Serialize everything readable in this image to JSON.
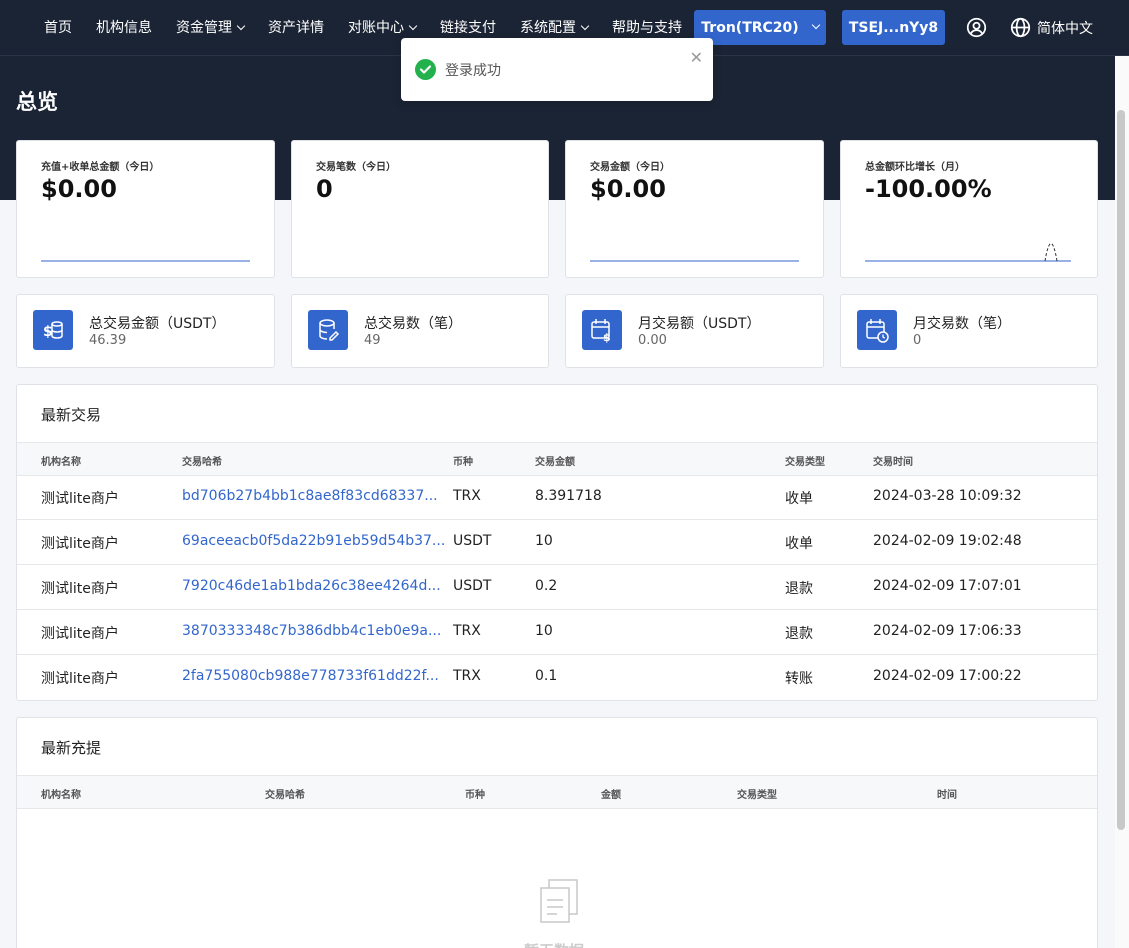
{
  "nav": {
    "items": [
      {
        "label": "首页"
      },
      {
        "label": "机构信息"
      },
      {
        "label": "资金管理"
      },
      {
        "label": "资产详情"
      },
      {
        "label": "对账中心"
      },
      {
        "label": "链接支付"
      },
      {
        "label": "系统配置"
      },
      {
        "label": "帮助与支持"
      }
    ],
    "network_label": "Tron(TRC20)",
    "wallet_label": "TSEJ...nYy8",
    "language": "简体中文",
    "user_icon": "user-circle-icon",
    "globe_icon": "globe-icon"
  },
  "toast": {
    "message": "登录成功",
    "icon": "check-circle-icon",
    "close_icon": "close-icon"
  },
  "page": {
    "title": "总览"
  },
  "stats": [
    {
      "label": "充值+收单总金额（今日）",
      "value": "$0.00"
    },
    {
      "label": "交易笔数（今日）",
      "value": "0"
    },
    {
      "label": "交易金额（今日）",
      "value": "$0.00"
    },
    {
      "label": "总金额环比增长（月）",
      "value": "-100.00%"
    }
  ],
  "summary": [
    {
      "label": "总交易金额（USDT）",
      "value": "46.39",
      "icon": "dollar-coins-icon"
    },
    {
      "label": "总交易数（笔）",
      "value": "49",
      "icon": "database-edit-icon"
    },
    {
      "label": "月交易额（USDT）",
      "value": "0.00",
      "icon": "calendar-dollar-icon"
    },
    {
      "label": "月交易数（笔）",
      "value": "0",
      "icon": "calendar-clock-icon"
    }
  ],
  "latest_tx": {
    "title": "最新交易",
    "columns": [
      "机构名称",
      "交易哈希",
      "币种",
      "交易金额",
      "交易类型",
      "交易时间"
    ],
    "rows": [
      {
        "org": "测试lite商户",
        "hash": "bd706b27b4bb1c8ae8f83cd68337...",
        "coin": "TRX",
        "amount": "8.391718",
        "type": "收单",
        "time": "2024-03-28 10:09:32"
      },
      {
        "org": "测试lite商户",
        "hash": "69aceeacb0f5da22b91eb59d54b37...",
        "coin": "USDT",
        "amount": "10",
        "type": "收单",
        "time": "2024-02-09 19:02:48"
      },
      {
        "org": "测试lite商户",
        "hash": "7920c46de1ab1bda26c38ee4264d...",
        "coin": "USDT",
        "amount": "0.2",
        "type": "退款",
        "time": "2024-02-09 17:07:01"
      },
      {
        "org": "测试lite商户",
        "hash": "3870333348c7b386dbb4c1eb0e9a...",
        "coin": "TRX",
        "amount": "10",
        "type": "退款",
        "time": "2024-02-09 17:06:33"
      },
      {
        "org": "测试lite商户",
        "hash": "2fa755080cb988e778733f61dd22f...",
        "coin": "TRX",
        "amount": "0.1",
        "type": "转账",
        "time": "2024-02-09 17:00:22"
      }
    ]
  },
  "latest_deposit": {
    "title": "最新充提",
    "columns": [
      "机构名称",
      "交易哈希",
      "币种",
      "金额",
      "交易类型",
      "时间"
    ],
    "empty_text": "暂无数据",
    "empty_icon": "empty-documents-icon"
  },
  "colors": {
    "header_bg": "#1b2434",
    "accent": "#3366cc",
    "success": "#22b14c"
  }
}
